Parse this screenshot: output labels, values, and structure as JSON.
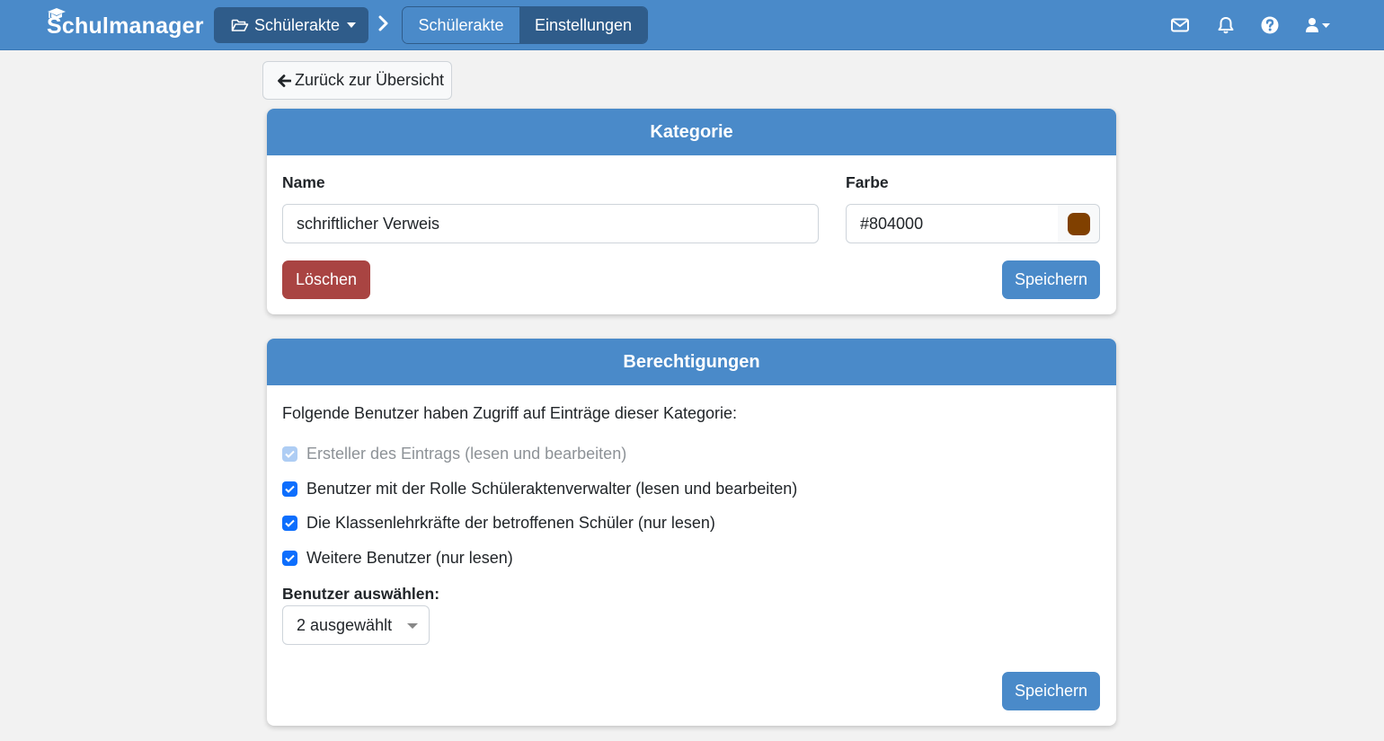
{
  "navbar": {
    "logo_text": "Schulmanager",
    "module_dropdown_label": "Schülerakte",
    "tabs": [
      {
        "label": "Schülerakte"
      },
      {
        "label": "Einstellungen"
      }
    ],
    "icons": [
      "mail-icon",
      "bell-icon",
      "help-icon",
      "user-icon"
    ]
  },
  "back_button": {
    "label": "Zurück zur Übersicht"
  },
  "kategorie": {
    "title": "Kategorie",
    "name_label": "Name",
    "name_value": "schriftlicher Verweis",
    "farbe_label": "Farbe",
    "farbe_value": "#804000",
    "delete_label": "Löschen",
    "save_label": "Speichern"
  },
  "berechtigungen": {
    "title": "Berechtigungen",
    "description": "Folgende Benutzer haben Zugriff auf Einträge dieser Kategorie:",
    "options": [
      {
        "label": "Ersteller des Eintrags (lesen und bearbeiten)",
        "checked": true,
        "disabled": true
      },
      {
        "label": "Benutzer mit der Rolle Schüleraktenverwalter (lesen und bearbeiten)",
        "checked": true,
        "disabled": false
      },
      {
        "label": "Die Klassenlehrkräfte der betroffenen Schüler (nur lesen)",
        "checked": true,
        "disabled": false
      },
      {
        "label": "Weitere Benutzer (nur lesen)",
        "checked": true,
        "disabled": false
      }
    ],
    "select_label": "Benutzer auswählen:",
    "select_value": "2 ausgewählt",
    "save_label": "Speichern"
  },
  "colors": {
    "primary": "#4a8ac9",
    "dark_nav": "#2f5c8a",
    "danger": "#a94442",
    "checkbox": "#0d6efd",
    "swatch": "#804000"
  }
}
